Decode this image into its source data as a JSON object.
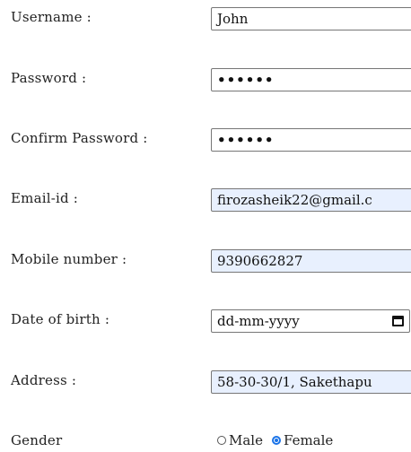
{
  "form": {
    "username": {
      "label": "Username :",
      "value": "John"
    },
    "password": {
      "label": "Password :",
      "value": "••••••"
    },
    "confirm_password": {
      "label": "Confirm Password :",
      "value": "••••••"
    },
    "email": {
      "label": "Email-id :",
      "value": "firozasheik22@gmail.c"
    },
    "mobile": {
      "label": "Mobile number :",
      "value": "9390662827"
    },
    "dob": {
      "label": "Date of birth :",
      "value": "dd-mm-yyyy"
    },
    "address": {
      "label": "Address :",
      "value": "58-30-30/1, Sakethapu"
    },
    "gender": {
      "label": "Gender",
      "options": [
        "Male",
        "Female"
      ],
      "selected": "Female"
    }
  },
  "icons": {
    "calendar": "calendar-icon"
  },
  "colors": {
    "autofill_bg": "#e8f0fe",
    "radio_selected": "#1a73e8"
  }
}
